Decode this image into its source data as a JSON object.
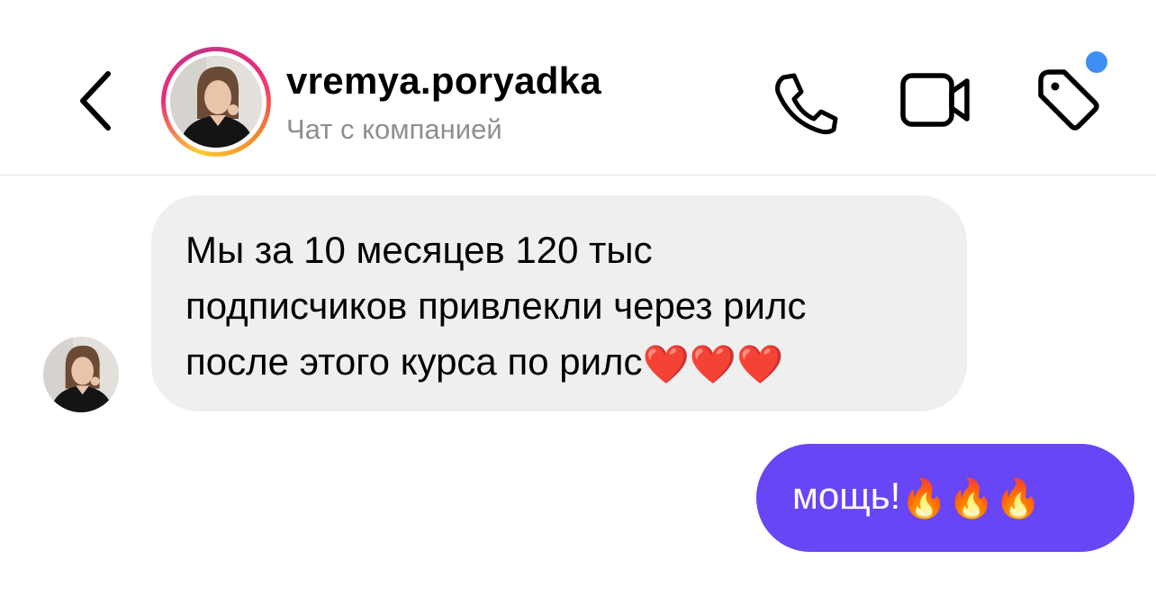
{
  "header": {
    "username": "vremya.poryadka",
    "subtitle": "Чат с компанией",
    "icons": {
      "back": "chevron-left-icon",
      "call": "phone-icon",
      "video": "video-camera-icon",
      "tag": "tag-icon"
    },
    "notification_dot_color": "#3d8ff5"
  },
  "messages": [
    {
      "direction": "incoming",
      "text": "Мы за 10 месяцев 120 тыс\nподписчиков привлекли через рилс\nпосле этого курса по рилс",
      "emoji": "❤️❤️❤️",
      "bubble_color": "#efeff0"
    },
    {
      "direction": "outgoing",
      "text": "мощь!",
      "emoji": "🔥🔥🔥",
      "bubble_color": "#6845f5"
    }
  ],
  "colors": {
    "outgoing_bubble": "#6845f5",
    "incoming_bubble": "#efeff0",
    "subtitle": "#8e8e93"
  }
}
